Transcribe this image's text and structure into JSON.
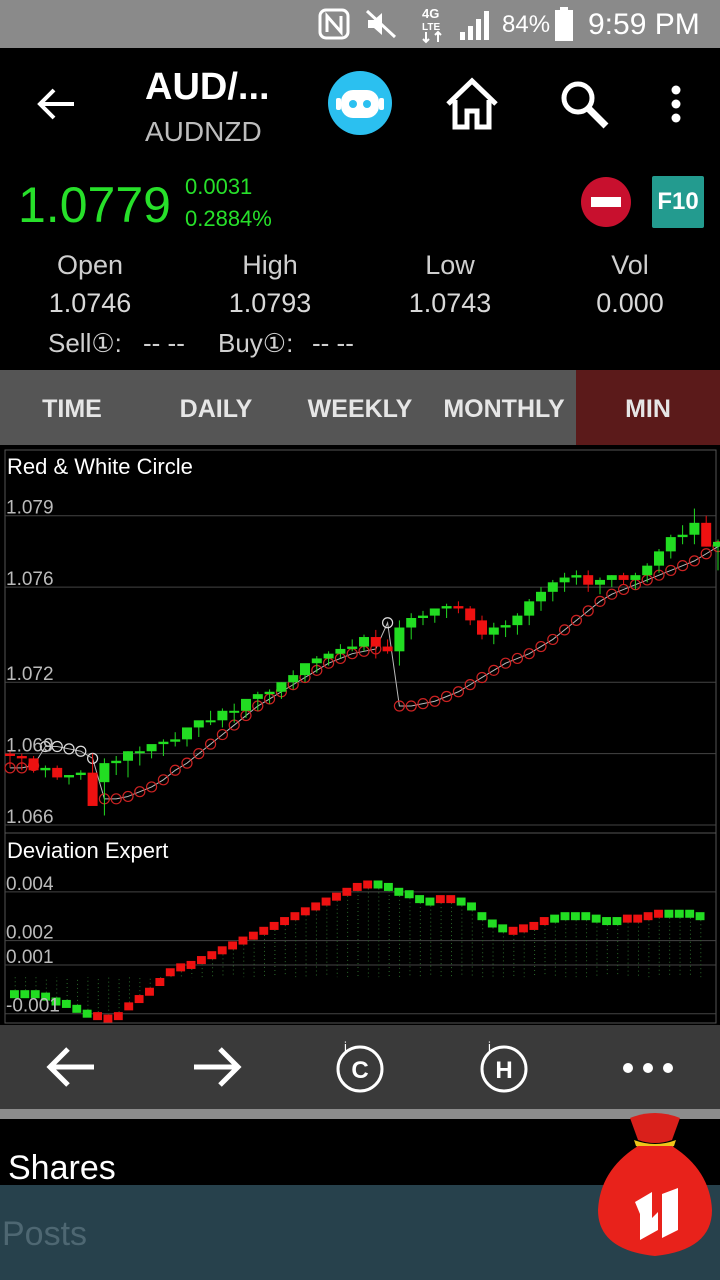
{
  "status_bar": {
    "battery": "84%",
    "time": "9:59 PM"
  },
  "header": {
    "title": "AUD/...",
    "subtitle": "AUDNZD",
    "price": "1.0779",
    "change": "0.0031",
    "change_pct": "0.2884%",
    "f10_label": "F10",
    "stats": [
      {
        "label": "Open",
        "value": "1.0746"
      },
      {
        "label": "High",
        "value": "1.0793"
      },
      {
        "label": "Low",
        "value": "1.0743"
      },
      {
        "label": "Vol",
        "value": "0.000"
      }
    ],
    "sell_label": "Sell①:",
    "sell_value": "-- --",
    "buy_label": "Buy①:",
    "buy_value": "-- --"
  },
  "tabs": [
    {
      "label": "TIME"
    },
    {
      "label": "DAILY"
    },
    {
      "label": "WEEKLY"
    },
    {
      "label": "MONTHLY"
    },
    {
      "label": "MIN",
      "active": true
    }
  ],
  "colors": {
    "up": "#22dd22",
    "down": "#ee1111",
    "accent": "#27e02a",
    "active_tab": "#5b1a1a"
  },
  "chart_data": [
    {
      "type": "candlestick",
      "title": "Red & White Circle",
      "yticks": [
        "1.079",
        "1.076",
        "1.072",
        "1.069",
        "1.066"
      ],
      "ylim": [
        1.066,
        1.0805
      ],
      "candles": [
        [
          1.069,
          1.0691,
          1.0684,
          1.0689
        ],
        [
          1.0689,
          1.069,
          1.0683,
          1.0688
        ],
        [
          1.0688,
          1.0689,
          1.0682,
          1.0683
        ],
        [
          1.0683,
          1.0685,
          1.068,
          1.0684
        ],
        [
          1.0684,
          1.0685,
          1.0679,
          1.068
        ],
        [
          1.068,
          1.0681,
          1.0677,
          1.0681
        ],
        [
          1.0681,
          1.0683,
          1.0679,
          1.0682
        ],
        [
          1.0682,
          1.069,
          1.0671,
          1.0668
        ],
        [
          1.0678,
          1.0688,
          1.0664,
          1.0686
        ],
        [
          1.0686,
          1.0689,
          1.0681,
          1.0687
        ],
        [
          1.0687,
          1.0691,
          1.068,
          1.0691
        ],
        [
          1.0691,
          1.0693,
          1.0685,
          1.0691
        ],
        [
          1.0691,
          1.0693,
          1.0688,
          1.0694
        ],
        [
          1.0694,
          1.0696,
          1.0689,
          1.0695
        ],
        [
          1.0695,
          1.0699,
          1.0693,
          1.0696
        ],
        [
          1.0696,
          1.07,
          1.0693,
          1.0701
        ],
        [
          1.0701,
          1.0703,
          1.0697,
          1.0704
        ],
        [
          1.0704,
          1.0708,
          1.0702,
          1.0704
        ],
        [
          1.0704,
          1.0709,
          1.0701,
          1.0708
        ],
        [
          1.0708,
          1.0711,
          1.0703,
          1.0708
        ],
        [
          1.0708,
          1.0712,
          1.0705,
          1.0713
        ],
        [
          1.0713,
          1.0716,
          1.0708,
          1.0715
        ],
        [
          1.0715,
          1.0717,
          1.0711,
          1.0716
        ],
        [
          1.0716,
          1.072,
          1.0713,
          1.072
        ],
        [
          1.072,
          1.0725,
          1.0717,
          1.0723
        ],
        [
          1.0723,
          1.0727,
          1.072,
          1.0728
        ],
        [
          1.0728,
          1.0731,
          1.0724,
          1.073
        ],
        [
          1.073,
          1.0733,
          1.0727,
          1.0732
        ],
        [
          1.0732,
          1.0736,
          1.073,
          1.0734
        ],
        [
          1.0734,
          1.0738,
          1.0733,
          1.0735
        ],
        [
          1.0735,
          1.074,
          1.0733,
          1.0739
        ],
        [
          1.0739,
          1.0742,
          1.073,
          1.0735
        ],
        [
          1.0735,
          1.0738,
          1.0732,
          1.0733
        ],
        [
          1.0733,
          1.0746,
          1.0727,
          1.0743
        ],
        [
          1.0743,
          1.0749,
          1.0738,
          1.0747
        ],
        [
          1.0747,
          1.075,
          1.0744,
          1.0748
        ],
        [
          1.0748,
          1.0751,
          1.0745,
          1.0751
        ],
        [
          1.0751,
          1.0753,
          1.0747,
          1.0752
        ],
        [
          1.0752,
          1.0754,
          1.0749,
          1.0751
        ],
        [
          1.0751,
          1.0752,
          1.0744,
          1.0746
        ],
        [
          1.0746,
          1.0748,
          1.0738,
          1.074
        ],
        [
          1.074,
          1.0745,
          1.0736,
          1.0743
        ],
        [
          1.0743,
          1.0746,
          1.0739,
          1.0744
        ],
        [
          1.0744,
          1.0749,
          1.074,
          1.0748
        ],
        [
          1.0748,
          1.0755,
          1.0744,
          1.0754
        ],
        [
          1.0754,
          1.076,
          1.075,
          1.0758
        ],
        [
          1.0758,
          1.0763,
          1.0754,
          1.0762
        ],
        [
          1.0762,
          1.0766,
          1.0758,
          1.0764
        ],
        [
          1.0764,
          1.0767,
          1.0761,
          1.0765
        ],
        [
          1.0765,
          1.0767,
          1.0758,
          1.0761
        ],
        [
          1.0761,
          1.0764,
          1.0757,
          1.0763
        ],
        [
          1.0763,
          1.0765,
          1.076,
          1.0765
        ],
        [
          1.0765,
          1.0766,
          1.0761,
          1.0763
        ],
        [
          1.0763,
          1.0766,
          1.0759,
          1.0765
        ],
        [
          1.0765,
          1.077,
          1.0762,
          1.0769
        ],
        [
          1.0769,
          1.0776,
          1.0766,
          1.0775
        ],
        [
          1.0775,
          1.0782,
          1.0772,
          1.0781
        ],
        [
          1.0781,
          1.0786,
          1.0778,
          1.0782
        ],
        [
          1.0782,
          1.0793,
          1.0778,
          1.0787
        ],
        [
          1.0787,
          1.079,
          1.0777,
          1.0777
        ],
        [
          1.0777,
          1.078,
          1.0767,
          1.0779
        ]
      ],
      "circles": [
        1.0684,
        1.0684,
        1.0685,
        1.0693,
        1.0693,
        1.0692,
        1.0691,
        1.0688,
        1.0671,
        1.0671,
        1.0672,
        1.0674,
        1.0676,
        1.0679,
        1.0683,
        1.0686,
        1.069,
        1.0694,
        1.0698,
        1.0702,
        1.0706,
        1.071,
        1.0713,
        1.0716,
        1.0719,
        1.0722,
        1.0725,
        1.0728,
        1.073,
        1.0732,
        1.0733,
        1.0734,
        1.0745,
        1.071,
        1.071,
        1.0711,
        1.0712,
        1.0714,
        1.0716,
        1.0719,
        1.0722,
        1.0725,
        1.0728,
        1.073,
        1.0732,
        1.0735,
        1.0738,
        1.0742,
        1.0746,
        1.075,
        1.0754,
        1.0757,
        1.0759,
        1.0761,
        1.0763,
        1.0765,
        1.0767,
        1.0769,
        1.0771,
        1.0774,
        1.0777,
        1.0779,
        1.0791
      ]
    },
    {
      "type": "bar",
      "title": "Deviation Expert",
      "yticks": [
        "0.004",
        "0.002",
        "0.001",
        "-0.001"
      ],
      "ylim": [
        -0.0013,
        0.0051
      ],
      "values": [
        -0.0002,
        -0.0002,
        -0.0002,
        -0.0003,
        -0.0005,
        -0.0006,
        -0.0008,
        -0.001,
        -0.0011,
        -0.0012,
        -0.0011,
        -0.0007,
        -0.0004,
        -0.0001,
        0.0003,
        0.0007,
        0.0009,
        0.001,
        0.0012,
        0.0014,
        0.0016,
        0.0018,
        0.002,
        0.0022,
        0.0024,
        0.0026,
        0.0028,
        0.003,
        0.0032,
        0.0034,
        0.0036,
        0.0038,
        0.004,
        0.0042,
        0.0043,
        0.0043,
        0.0042,
        0.004,
        0.0039,
        0.0037,
        0.0036,
        0.0037,
        0.0037,
        0.0036,
        0.0034,
        0.003,
        0.0027,
        0.0025,
        0.0024,
        0.0025,
        0.0026,
        0.0028,
        0.0029,
        0.003,
        0.003,
        0.003,
        0.0029,
        0.0028,
        0.0028,
        0.0029,
        0.0029,
        0.003,
        0.0031,
        0.0031,
        0.0031,
        0.0031,
        0.003
      ],
      "colors": [
        "up",
        "up",
        "up",
        "up",
        "up",
        "up",
        "up",
        "up",
        "down",
        "down",
        "down",
        "down",
        "down",
        "down",
        "down",
        "down",
        "down",
        "down",
        "down",
        "down",
        "down",
        "down",
        "down",
        "down",
        "down",
        "down",
        "down",
        "down",
        "down",
        "down",
        "down",
        "down",
        "down",
        "down",
        "down",
        "up",
        "up",
        "up",
        "up",
        "up",
        "up",
        "down",
        "down",
        "up",
        "up",
        "up",
        "up",
        "up",
        "down",
        "down",
        "down",
        "down",
        "up",
        "up",
        "up",
        "up",
        "up",
        "up",
        "up",
        "down",
        "down",
        "down",
        "down",
        "up",
        "up",
        "up",
        "up"
      ]
    }
  ]
}
